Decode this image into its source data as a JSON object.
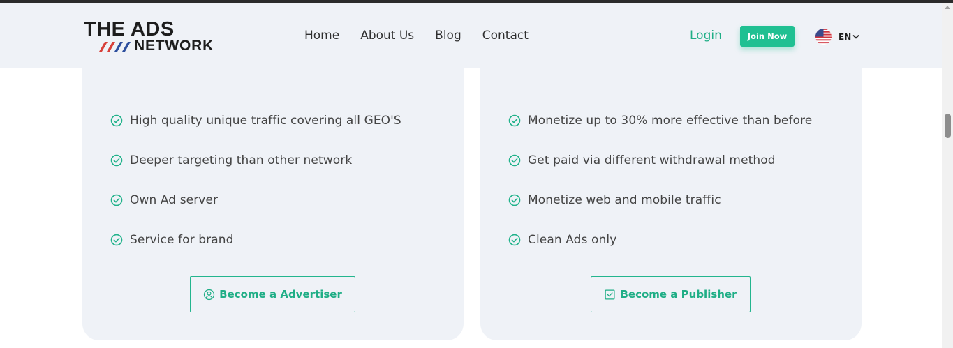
{
  "header": {
    "logo": {
      "line1": "THE ADS",
      "line2": "NETWORK"
    },
    "nav": [
      "Home",
      "About Us",
      "Blog",
      "Contact"
    ],
    "login_label": "Login",
    "join_label": "Join Now",
    "language": {
      "code": "EN",
      "flag_icon": "us-flag-icon"
    }
  },
  "advertiser_card": {
    "features": [
      "High quality unique traffic covering all GEO'S",
      "Deeper targeting than other network",
      "Own Ad server",
      "Service for brand"
    ],
    "cta_label": "Become a Advertiser",
    "cta_icon": "user-circle-icon"
  },
  "publisher_card": {
    "features": [
      "Monetize up to 30% more effective than before",
      "Get paid via different withdrawal method",
      "Monetize web and mobile traffic",
      "Clean Ads only"
    ],
    "cta_label": "Become a Publisher",
    "cta_icon": "check-square-icon"
  },
  "colors": {
    "accent": "#20c092",
    "card_bg": "#eff2f7",
    "text": "#444444"
  }
}
